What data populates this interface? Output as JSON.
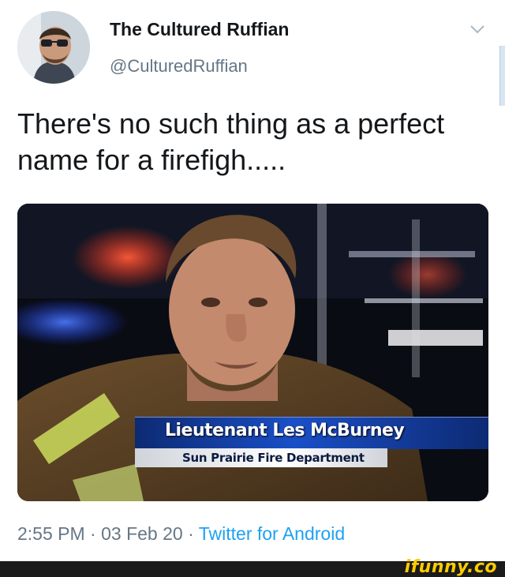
{
  "tweet": {
    "display_name": "The Cultured Ruffian",
    "handle": "@CulturedRuffian",
    "text": "There's no such thing as a perfect name for a firefigh.....",
    "avatar_icon": "avatar-photo",
    "menu_icon": "chevron-down-icon",
    "media": {
      "caption_name": "Lieutenant Les McBurney",
      "caption_department": "Sun Prairie Fire Department"
    },
    "time": "2:55 PM",
    "date": "03 Feb 20",
    "source": "Twitter for Android",
    "separator": "·"
  },
  "watermark": {
    "text": "ifunny.co",
    "color": "#ffcc00"
  },
  "colors": {
    "text": "#14171a",
    "muted": "#657786",
    "link": "#1da1f2"
  }
}
